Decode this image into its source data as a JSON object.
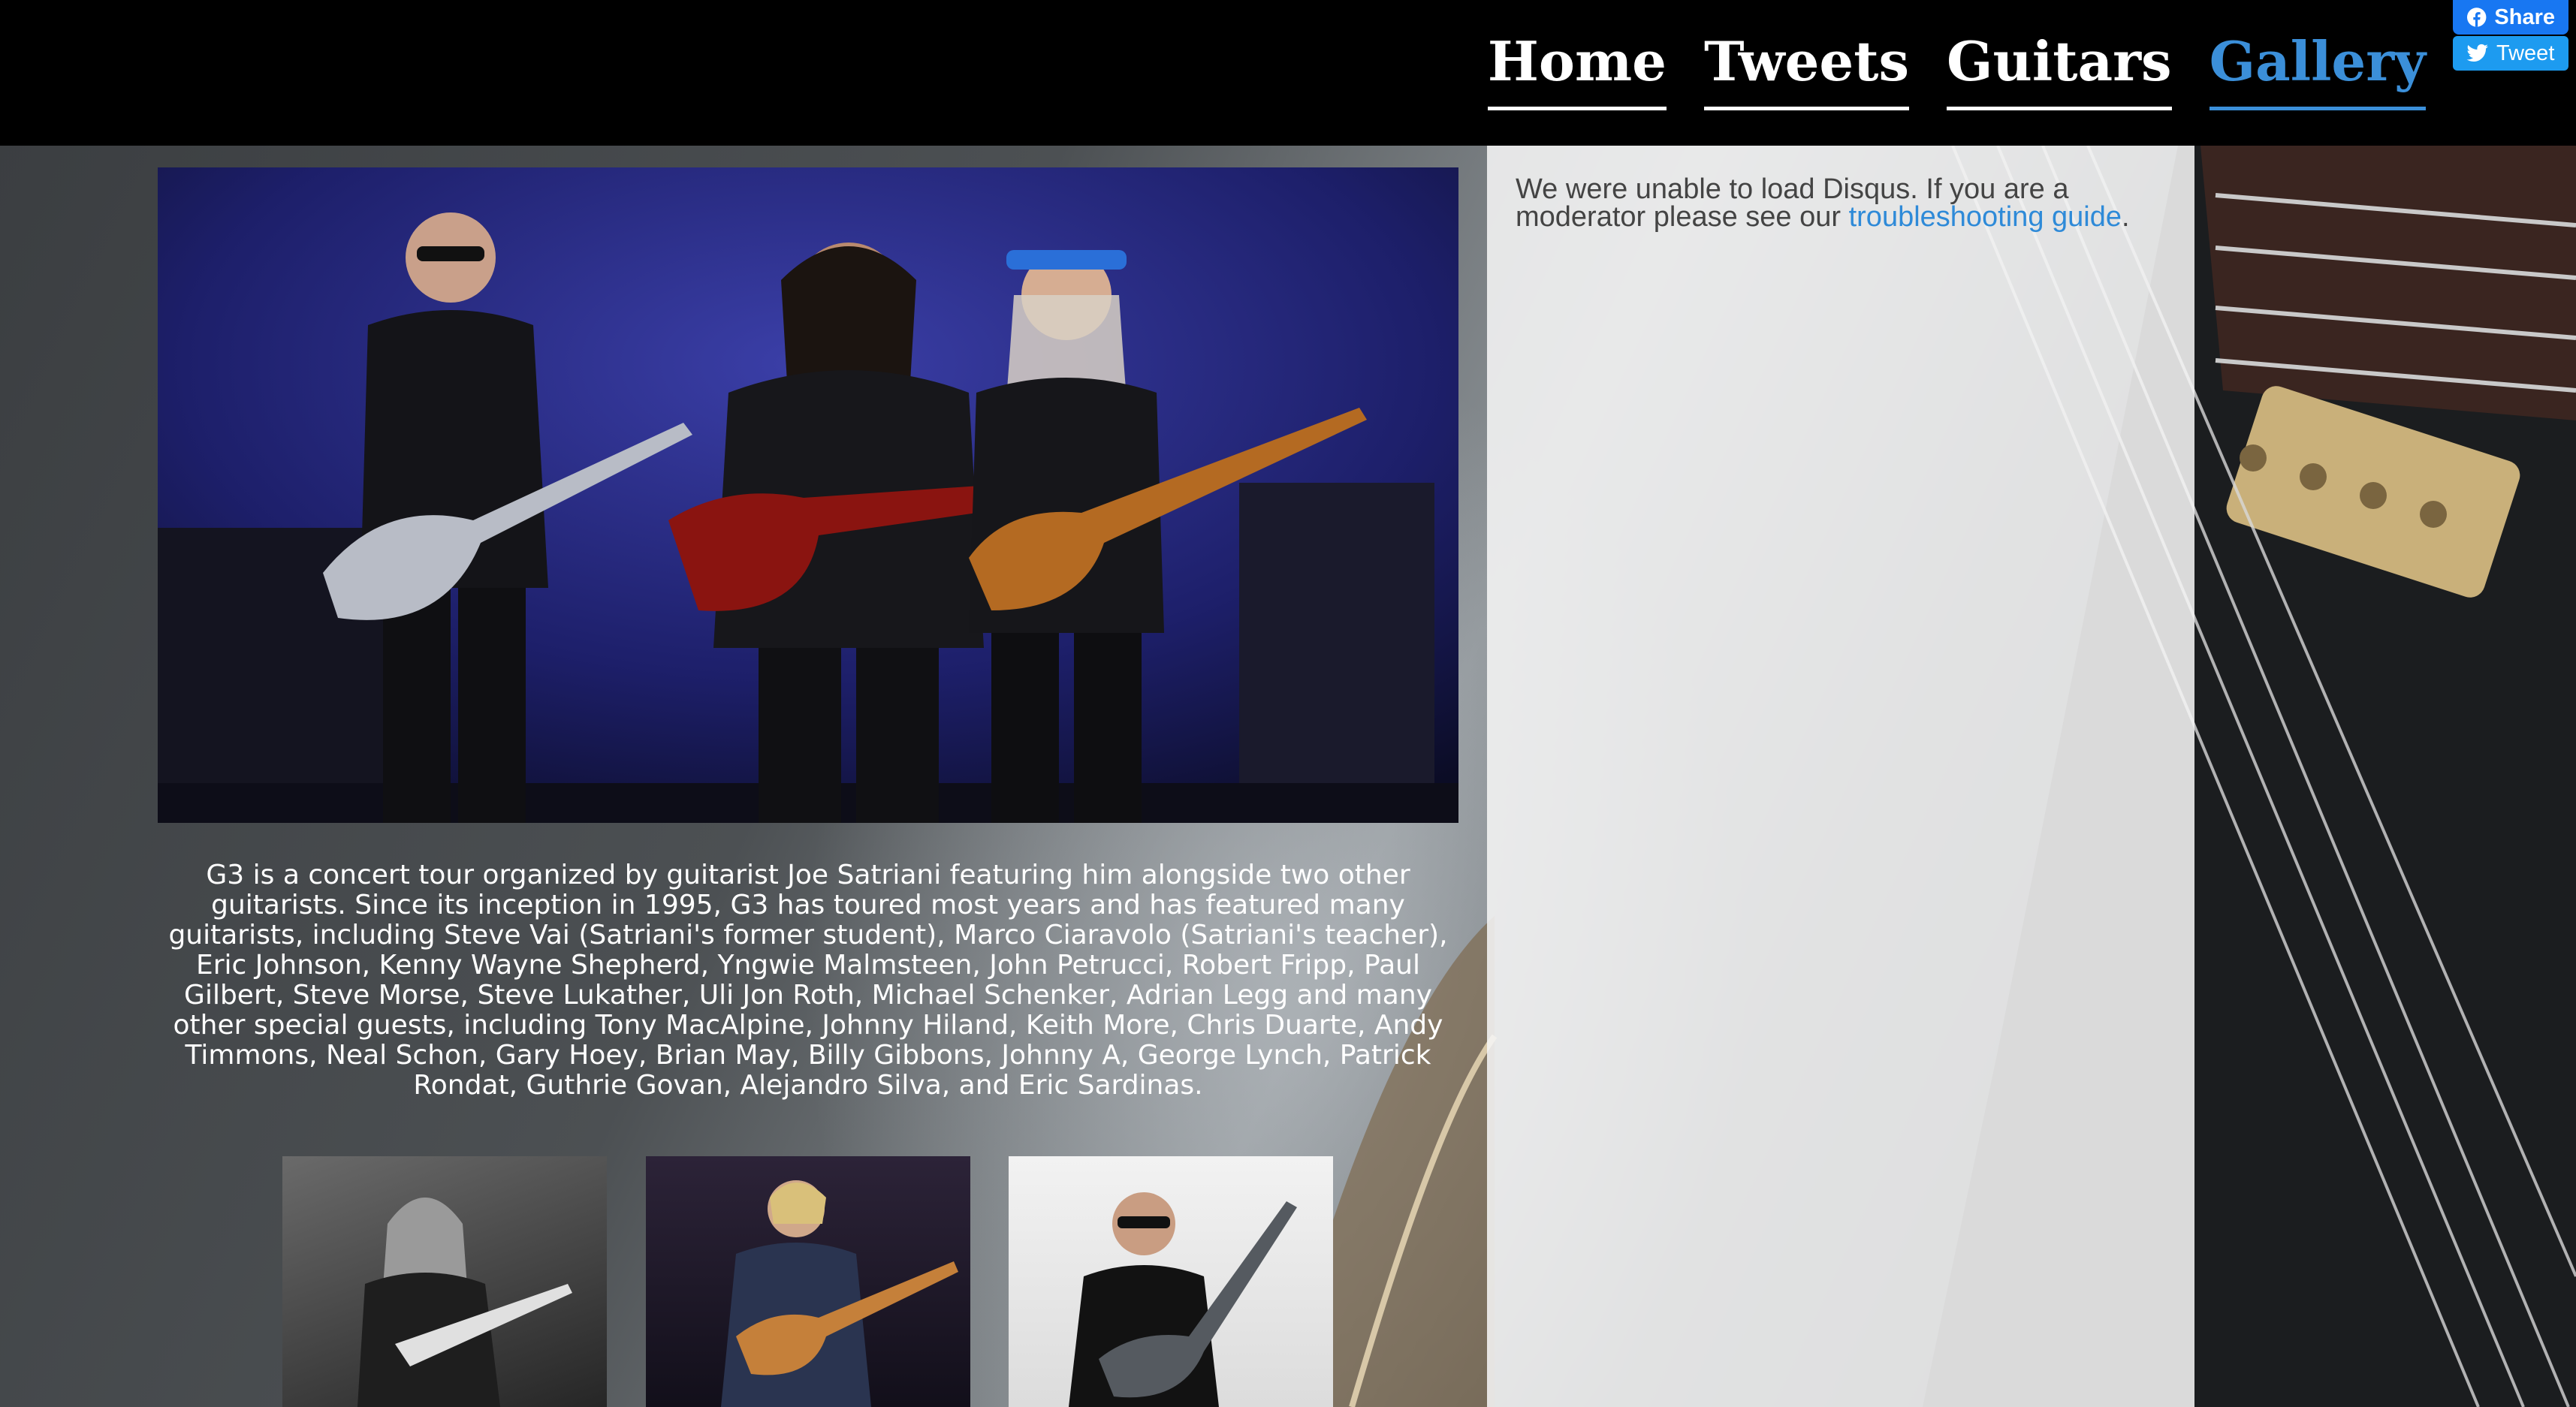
{
  "nav": {
    "items": [
      {
        "label": "Home"
      },
      {
        "label": "Tweets"
      },
      {
        "label": "Guitars"
      },
      {
        "label": "Gallery",
        "active": true
      }
    ]
  },
  "social": {
    "share_label": "Share",
    "tweet_label": "Tweet"
  },
  "main": {
    "description": "G3 is a concert tour organized by guitarist Joe Satriani featuring him alongside two other guitarists. Since its inception in 1995, G3 has toured most years and has featured many guitarists, including Steve Vai (Satriani's former student), Marco Ciaravolo (Satriani's teacher), Eric Johnson, Kenny Wayne Shepherd, Yngwie Malmsteen, John Petrucci, Robert Fripp, Paul Gilbert, Steve Morse, Steve Lukather, Uli Jon Roth, Michael Schenker, Adrian Legg and many other special guests, including Tony MacAlpine, Johnny Hiland, Keith More, Chris Duarte, Andy Timmons, Neal Schon, Gary Hoey, Brian May, Billy Gibbons, Johnny A, George Lynch, Patrick Rondat, Guthrie Govan, Alejandro Silva, and Eric Sardinas."
  },
  "disqus": {
    "message_before": "We were unable to load Disqus. If you are a moderator please see our ",
    "link_text": "troubleshooting guide",
    "message_after": "."
  },
  "colors": {
    "header_bg": "#000000",
    "accent": "#3b8fd9",
    "link": "#2e8ad8",
    "facebook": "#1877f2",
    "twitter": "#1d9bf0"
  },
  "icons": [
    "facebook-icon",
    "twitter-icon"
  ]
}
